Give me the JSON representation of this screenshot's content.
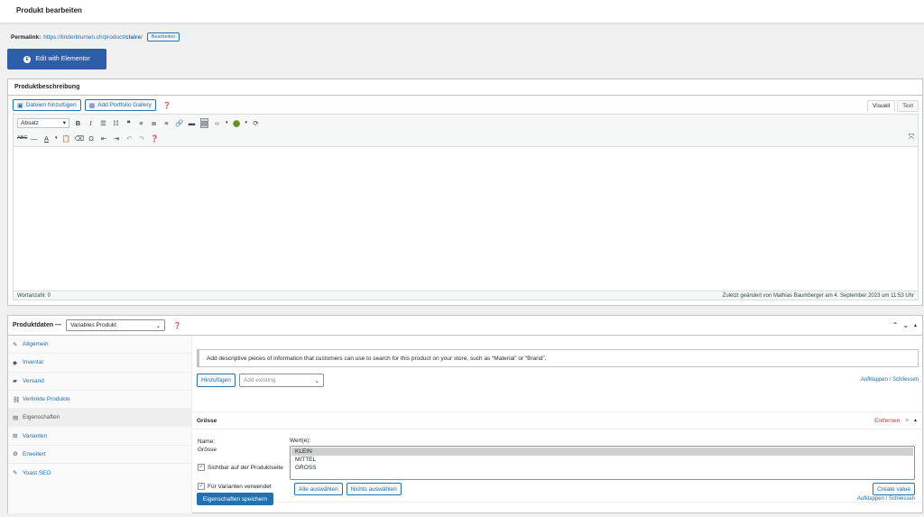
{
  "header": {
    "title": "Produkt bearbeiten"
  },
  "permalink": {
    "label": "Permalink:",
    "url_prefix": "https://linderblumen.ch/product/",
    "slug": "claire",
    "url_suffix": "/",
    "edit_label": "Bearbeiten"
  },
  "elementor": {
    "label": "Edit with Elementor"
  },
  "description": {
    "title": "Produktbeschreibung",
    "add_media": "Dateien hinzufügen",
    "add_gallery": "Add Portfolio Gallery",
    "tab_visual": "Visuell",
    "tab_text": "Text",
    "format_select": "Absatz",
    "word_count": "Wortanzahl: 0",
    "last_edited": "Zuletzt geändert von Mathias Baumberger am 4. September 2023 um 11:53 Uhr"
  },
  "product_data": {
    "label": "Produktdaten —",
    "type_select": "Variables Produkt",
    "tabs": [
      {
        "label": "Allgemein",
        "icon": "wrench-icon"
      },
      {
        "label": "Inventar",
        "icon": "diamond-icon"
      },
      {
        "label": "Versand",
        "icon": "truck-icon"
      },
      {
        "label": "Verlinkte Produkte",
        "icon": "link-icon"
      },
      {
        "label": "Eigenschaften",
        "icon": "table-icon"
      },
      {
        "label": "Varianten",
        "icon": "grid-icon"
      },
      {
        "label": "Erweitert",
        "icon": "gear-icon"
      },
      {
        "label": "Yoast SEO",
        "icon": "wrench-icon"
      }
    ],
    "notice": "Add descriptive pieces of information that customers can use to search for this product on your store, such as “Material” or “Brand”.",
    "add_button": "Hinzufügen",
    "add_existing_placeholder": "Add existing",
    "expand_link": "Aufklappen",
    "collapse_link": "Schliessen",
    "link_separator": " / ",
    "attribute": {
      "title": "Grösse",
      "remove": "Entfernen",
      "name_label": "Name:",
      "name_value": "Grösse",
      "values_label": "Wert(e):",
      "values": [
        "KLEIN",
        "MITTEL",
        "GROSS"
      ],
      "visible_label": "Sichtbar auf der Produktseite",
      "variations_label": "Für Varianten verwendet",
      "select_all": "Alle auswählen",
      "select_none": "Nichts auswählen",
      "create_value": "Create value"
    },
    "save_button": "Eigenschaften speichern"
  },
  "colors": {
    "accent": "#2271b1",
    "elementor": "#2d5fa8",
    "danger": "#d63638"
  }
}
